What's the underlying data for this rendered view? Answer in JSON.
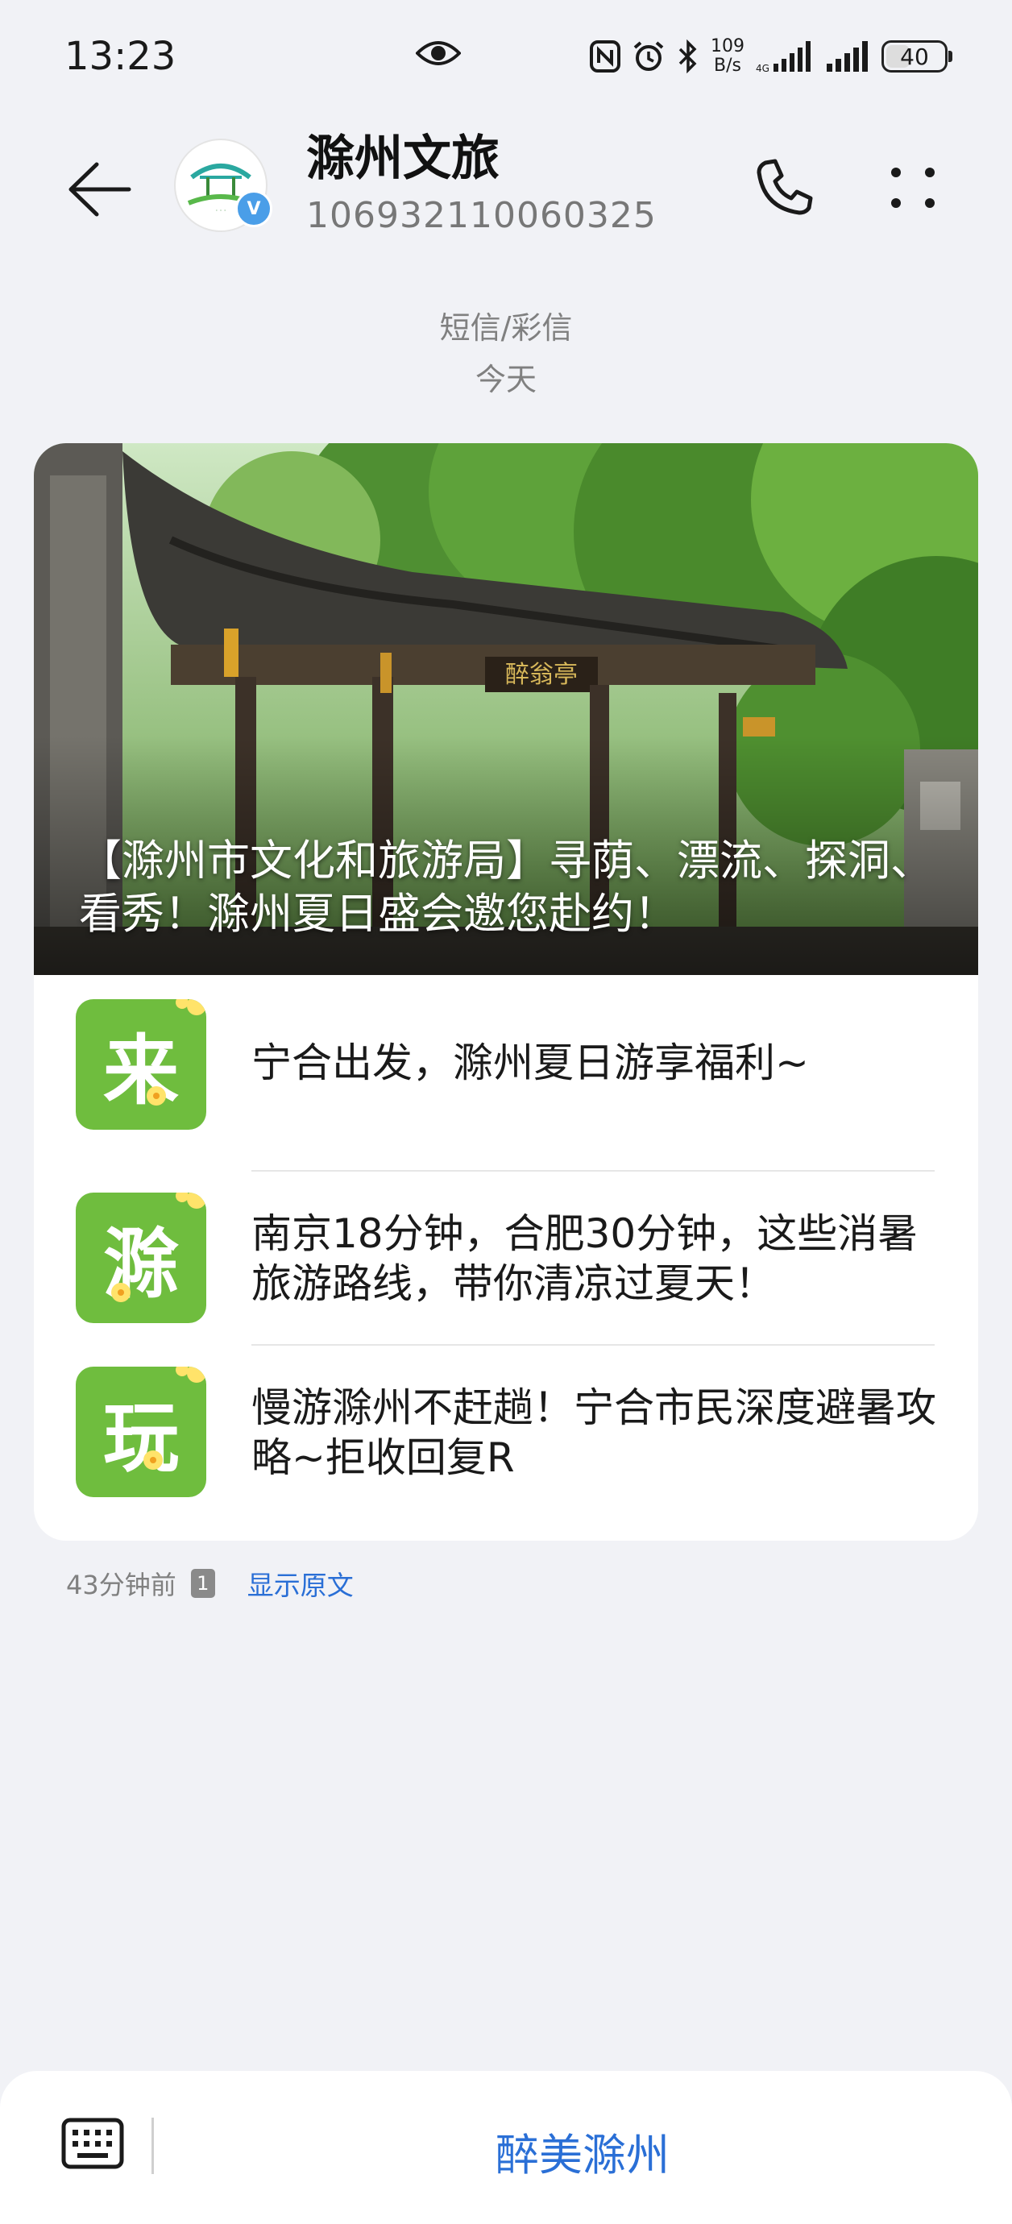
{
  "status_bar": {
    "time": "13:23",
    "net_speed_value": "109",
    "net_speed_unit": "B/s",
    "battery": "40",
    "battery_level": 0.4
  },
  "header": {
    "contact_name": "滁州文旅",
    "contact_number": "106932110060325",
    "avatar_icon": "pavilion-logo",
    "verified_mark": "V"
  },
  "conversation": {
    "message_type": "短信/彩信",
    "date_label": "今天"
  },
  "card": {
    "hero_title": "【滁州市文化和旅游局】寻荫、漂流、探洞、看秀！滁州夏日盛会邀您赴约！",
    "items": [
      {
        "icon_char": "来",
        "text": "宁合出发，滁州夏日游享福利~"
      },
      {
        "icon_char": "滁",
        "text": "南京18分钟，合肥30分钟，这些消暑旅游路线，带你清凉过夏天！"
      },
      {
        "icon_char": "玩",
        "text": "慢游滁州不赶趟！宁合市民深度避暑攻略~拒收回复R"
      }
    ]
  },
  "meta": {
    "time_ago": "43分钟前",
    "sim": "1",
    "show_original": "显示原文"
  },
  "bottom": {
    "menu_label": "醉美滁州"
  },
  "colors": {
    "accent": "#2a6fd6",
    "icon_green": "#6fbd3e",
    "background": "#f1f2f6"
  }
}
